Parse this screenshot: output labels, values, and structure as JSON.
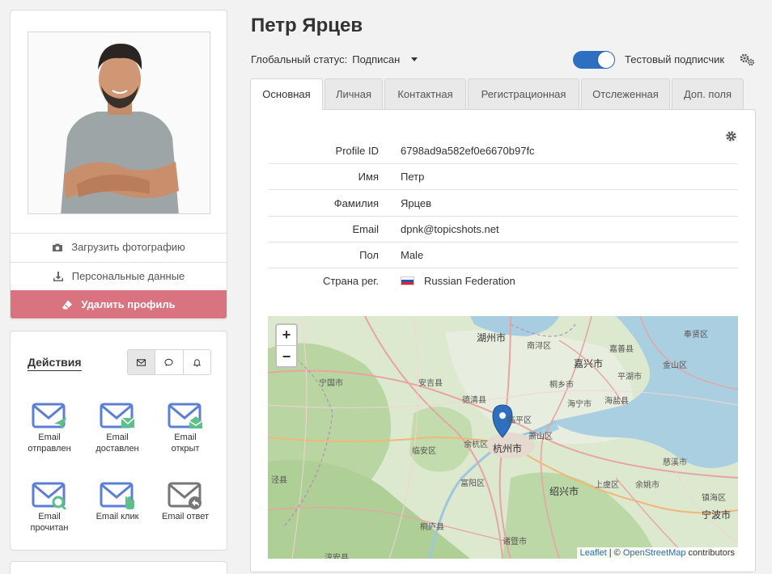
{
  "profile": {
    "upload_photo": "Загрузить фотографию",
    "personal_data": "Персональные данные",
    "delete_profile": "Удалить профиль"
  },
  "actions": {
    "title": "Действия",
    "filters": [
      "email-icon",
      "chat-icon",
      "bell-icon"
    ],
    "items": [
      {
        "label_1": "Email",
        "label_2": "отправлен"
      },
      {
        "label_1": "Email",
        "label_2": "доставлен"
      },
      {
        "label_1": "Email",
        "label_2": "открыт"
      },
      {
        "label_1": "Email",
        "label_2": "прочитан"
      },
      {
        "label_1": "Email клик",
        "label_2": ""
      },
      {
        "label_1": "Email ответ",
        "label_2": ""
      }
    ]
  },
  "header": {
    "name": "Петр Ярцев",
    "status_label": "Глобальный статус:",
    "status_value": "Подписан",
    "test_subscriber": "Тестовый подписчик",
    "test_toggle_on": true
  },
  "tabs": [
    "Основная",
    "Личная",
    "Контактная",
    "Регистрационная",
    "Отслеженная",
    "Доп. поля"
  ],
  "fields": [
    {
      "key": "Profile ID",
      "value": "6798ad9a582ef0e6670b97fc"
    },
    {
      "key": "Имя",
      "value": "Петр"
    },
    {
      "key": "Фамилия",
      "value": "Ярцев"
    },
    {
      "key": "Email",
      "value": "dpnk@topicshots.net"
    },
    {
      "key": "Пол",
      "value": "Male"
    },
    {
      "key": "Страна рег.",
      "value": "Russian Federation"
    }
  ],
  "map": {
    "zoom_in": "+",
    "zoom_out": "−",
    "attribution_leaflet": "Leaflet",
    "attribution_sep": " | © ",
    "attribution_osm": "OpenStreetMap",
    "attribution_tail": " contributors",
    "labels": [
      "湖州市",
      "嘉兴市",
      "杭州市",
      "绍兴市",
      "宁波市",
      "德清县",
      "安吉县",
      "宁国市",
      "桐乡市",
      "海宁市",
      "平湖市",
      "嘉善县",
      "南浔区",
      "余杭区",
      "临平区",
      "萧山区",
      "富阳区",
      "临安区",
      "诸暨市",
      "上虞区",
      "余姚市",
      "慈溪市",
      "海盐县",
      "金山区",
      "奉贤区",
      "桐庐县",
      "淳安县",
      "镇海区",
      "泾县"
    ]
  },
  "colors": {
    "accent": "#2e6fc1",
    "danger": "#d9737f",
    "email_icon": "#5b7fd4",
    "email_green": "#5bc08a"
  }
}
